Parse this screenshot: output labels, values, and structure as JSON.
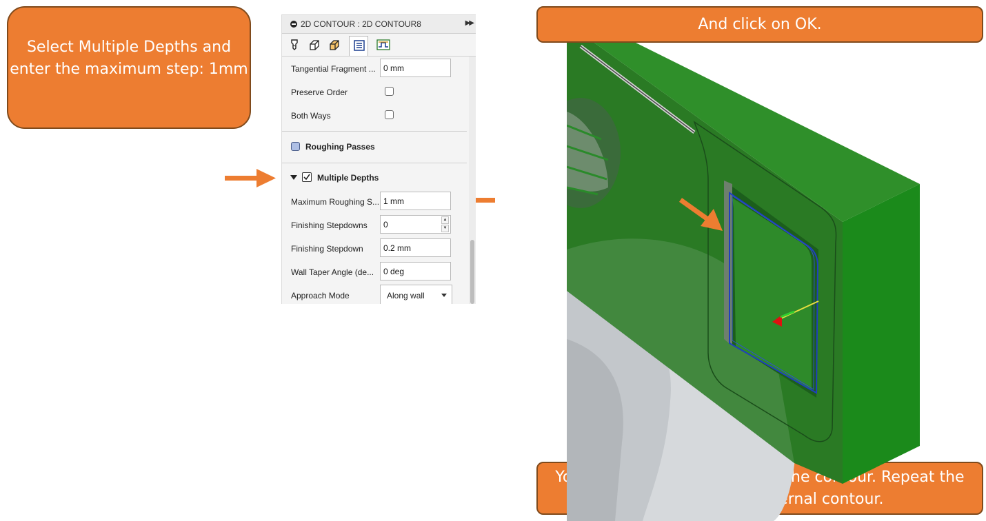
{
  "callouts": {
    "left": "Select Multiple Depths and enter the maximum step: 1mm",
    "top": "And click on OK.",
    "bottom": "You will obtain the pattern for the contour. Repeat the process for the external contour."
  },
  "panel": {
    "title": "2D CONTOUR : 2D CONTOUR8",
    "tabs": [
      "tool-icon",
      "geometry-icon",
      "heights-icon",
      "passes-icon",
      "linking-icon"
    ],
    "active_tab": 3,
    "rows": {
      "tangential_fragment": {
        "label": "Tangential Fragment ...",
        "value": "0 mm"
      },
      "preserve_order": {
        "label": "Preserve Order",
        "checked": false
      },
      "both_ways": {
        "label": "Both Ways",
        "checked": false
      }
    },
    "roughing_passes": {
      "label": "Roughing Passes",
      "checked": false
    },
    "multiple_depths": {
      "label": "Multiple Depths",
      "checked": true,
      "max_roughing": {
        "label": "Maximum Roughing S...",
        "value": "1 mm"
      },
      "finishing_stepdowns": {
        "label": "Finishing Stepdowns",
        "value": "0"
      },
      "finishing_stepdown": {
        "label": "Finishing Stepdown",
        "value": "0.2 mm"
      },
      "wall_taper": {
        "label": "Wall Taper Angle (de...",
        "value": "0 deg"
      },
      "approach_mode": {
        "label": "Approach Mode",
        "value": "Along wall"
      }
    }
  },
  "colors": {
    "callout": "#ed7d31",
    "callout_border": "#7f4a1c",
    "part_green": "#1e7a1e",
    "toolpath_blue": "#1f3fbf"
  }
}
